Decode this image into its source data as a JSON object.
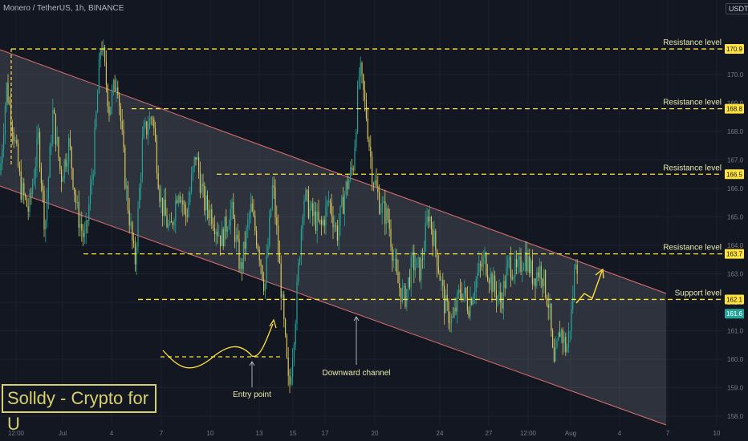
{
  "header": {
    "symbol_line": "Monero / TetherUS, 1h, BINANCE",
    "quote_badge": "USDT"
  },
  "branding": {
    "watermark": "Solldy - Crypto for U"
  },
  "chart_data": {
    "type": "candlestick",
    "title": "Monero / TetherUS, 1h, BINANCE",
    "y_axis": {
      "ticks": [
        "158.0",
        "159.0",
        "160.0",
        "161.0",
        "162.0",
        "163.0",
        "164.0",
        "165.0",
        "166.0",
        "167.0",
        "168.0",
        "169.0",
        "170.0"
      ],
      "range": [
        157.75,
        172.3
      ],
      "position": "right"
    },
    "x_axis": {
      "ticks": [
        "12:00",
        "Jul",
        "4",
        "7",
        "10",
        "13",
        "15",
        "17",
        "20",
        "24",
        "27",
        "12:00",
        "Aug",
        "4",
        "7",
        "10"
      ]
    },
    "price_path": [
      [
        0,
        166.5
      ],
      [
        8,
        169.6
      ],
      [
        16,
        168.2
      ],
      [
        26,
        166.0
      ],
      [
        36,
        165.2
      ],
      [
        48,
        167.8
      ],
      [
        56,
        164.6
      ],
      [
        66,
        168.7
      ],
      [
        76,
        166.4
      ],
      [
        86,
        167.6
      ],
      [
        96,
        165.2
      ],
      [
        106,
        164.1
      ],
      [
        116,
        166.8
      ],
      [
        126,
        171.3
      ],
      [
        136,
        168.8
      ],
      [
        146,
        170.0
      ],
      [
        156,
        166.3
      ],
      [
        168,
        163.3
      ],
      [
        178,
        167.8
      ],
      [
        190,
        168.6
      ],
      [
        200,
        165.6
      ],
      [
        212,
        164.4
      ],
      [
        222,
        166.1
      ],
      [
        232,
        165.0
      ],
      [
        244,
        167.2
      ],
      [
        254,
        165.5
      ],
      [
        264,
        165.1
      ],
      [
        276,
        164.2
      ],
      [
        288,
        165.3
      ],
      [
        300,
        163.1
      ],
      [
        312,
        165.3
      ],
      [
        322,
        164.0
      ],
      [
        330,
        162.5
      ],
      [
        340,
        166.2
      ],
      [
        350,
        162.6
      ],
      [
        360,
        158.8
      ],
      [
        368,
        161.5
      ],
      [
        378,
        165.8
      ],
      [
        388,
        165.1
      ],
      [
        400,
        164.6
      ],
      [
        410,
        165.6
      ],
      [
        420,
        164.4
      ],
      [
        430,
        165.9
      ],
      [
        440,
        166.8
      ],
      [
        448,
        170.2
      ],
      [
        456,
        168.7
      ],
      [
        464,
        166.5
      ],
      [
        474,
        165.4
      ],
      [
        484,
        164.9
      ],
      [
        494,
        162.8
      ],
      [
        504,
        162.1
      ],
      [
        514,
        163.4
      ],
      [
        524,
        163.1
      ],
      [
        534,
        165.2
      ],
      [
        544,
        163.7
      ],
      [
        554,
        161.9
      ],
      [
        564,
        161.3
      ],
      [
        574,
        162.5
      ],
      [
        584,
        161.9
      ],
      [
        594,
        162.9
      ],
      [
        604,
        163.5
      ],
      [
        614,
        162.6
      ],
      [
        624,
        162.0
      ],
      [
        634,
        163.4
      ],
      [
        644,
        163.0
      ],
      [
        654,
        163.7
      ],
      [
        664,
        162.9
      ],
      [
        674,
        163.2
      ],
      [
        684,
        161.9
      ],
      [
        690,
        159.6
      ],
      [
        698,
        161.1
      ],
      [
        706,
        160.3
      ],
      [
        712,
        161.6
      ],
      [
        718,
        163.9
      ],
      [
        722,
        162.3
      ]
    ],
    "levels": [
      {
        "label": "Resistance level",
        "value": 170.9
      },
      {
        "label": "Resistance level",
        "value": 168.8
      },
      {
        "label": "Resistance level",
        "value": 166.5
      },
      {
        "label": "Resistance level",
        "value": 163.7
      },
      {
        "label": "Support level",
        "value": 162.1
      }
    ],
    "last_price": {
      "value": 161.6,
      "color": "#26a69a"
    },
    "annotations": [
      "Entry point",
      "Downward channel"
    ],
    "colors": {
      "bull": "#26a69a",
      "bear": "#d6c45c",
      "level": "#ffe23b",
      "channel_edge": "#e07070",
      "channel_fill": "#b2b5be"
    }
  }
}
